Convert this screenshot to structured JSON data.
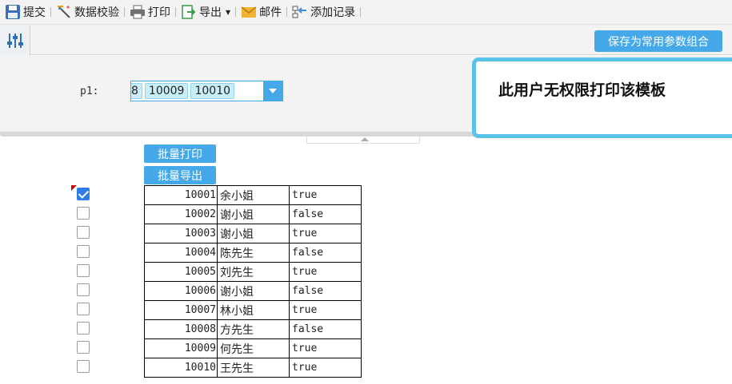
{
  "toolbar": {
    "submit": "提交",
    "validate": "数据校验",
    "print": "打印",
    "export": "导出",
    "mail": "邮件",
    "add_record": "添加记录"
  },
  "parambar": {
    "save_button": "保存为常用参数组合"
  },
  "params": {
    "p1_label": "p1:",
    "p1_values": [
      "8",
      "10009",
      "10010"
    ]
  },
  "toast": {
    "message": "此用户无权限打印该模板"
  },
  "report": {
    "batch_print": "批量打印",
    "batch_export": "批量导出",
    "rows": [
      {
        "id": "10001",
        "name": "余小姐",
        "flag": "true",
        "checked": true
      },
      {
        "id": "10002",
        "name": "谢小姐",
        "flag": "false",
        "checked": false
      },
      {
        "id": "10003",
        "name": "谢小姐",
        "flag": "true",
        "checked": false
      },
      {
        "id": "10004",
        "name": "陈先生",
        "flag": "false",
        "checked": false
      },
      {
        "id": "10005",
        "name": "刘先生",
        "flag": "true",
        "checked": false
      },
      {
        "id": "10006",
        "name": "谢小姐",
        "flag": "false",
        "checked": false
      },
      {
        "id": "10007",
        "name": "林小姐",
        "flag": "true",
        "checked": false
      },
      {
        "id": "10008",
        "name": "方先生",
        "flag": "false",
        "checked": false
      },
      {
        "id": "10009",
        "name": "何先生",
        "flag": "true",
        "checked": false
      },
      {
        "id": "10010",
        "name": "王先生",
        "flag": "true",
        "checked": false
      }
    ]
  },
  "colors": {
    "accent": "#45a8e8",
    "toast_border": "#5bc2ea",
    "checkbox_checked": "#2f7ee6"
  },
  "icons": [
    "save-icon",
    "validate-icon",
    "printer-icon",
    "export-icon",
    "mail-icon",
    "add-record-icon",
    "parameter-sliders-icon",
    "dropdown-arrow-icon"
  ]
}
